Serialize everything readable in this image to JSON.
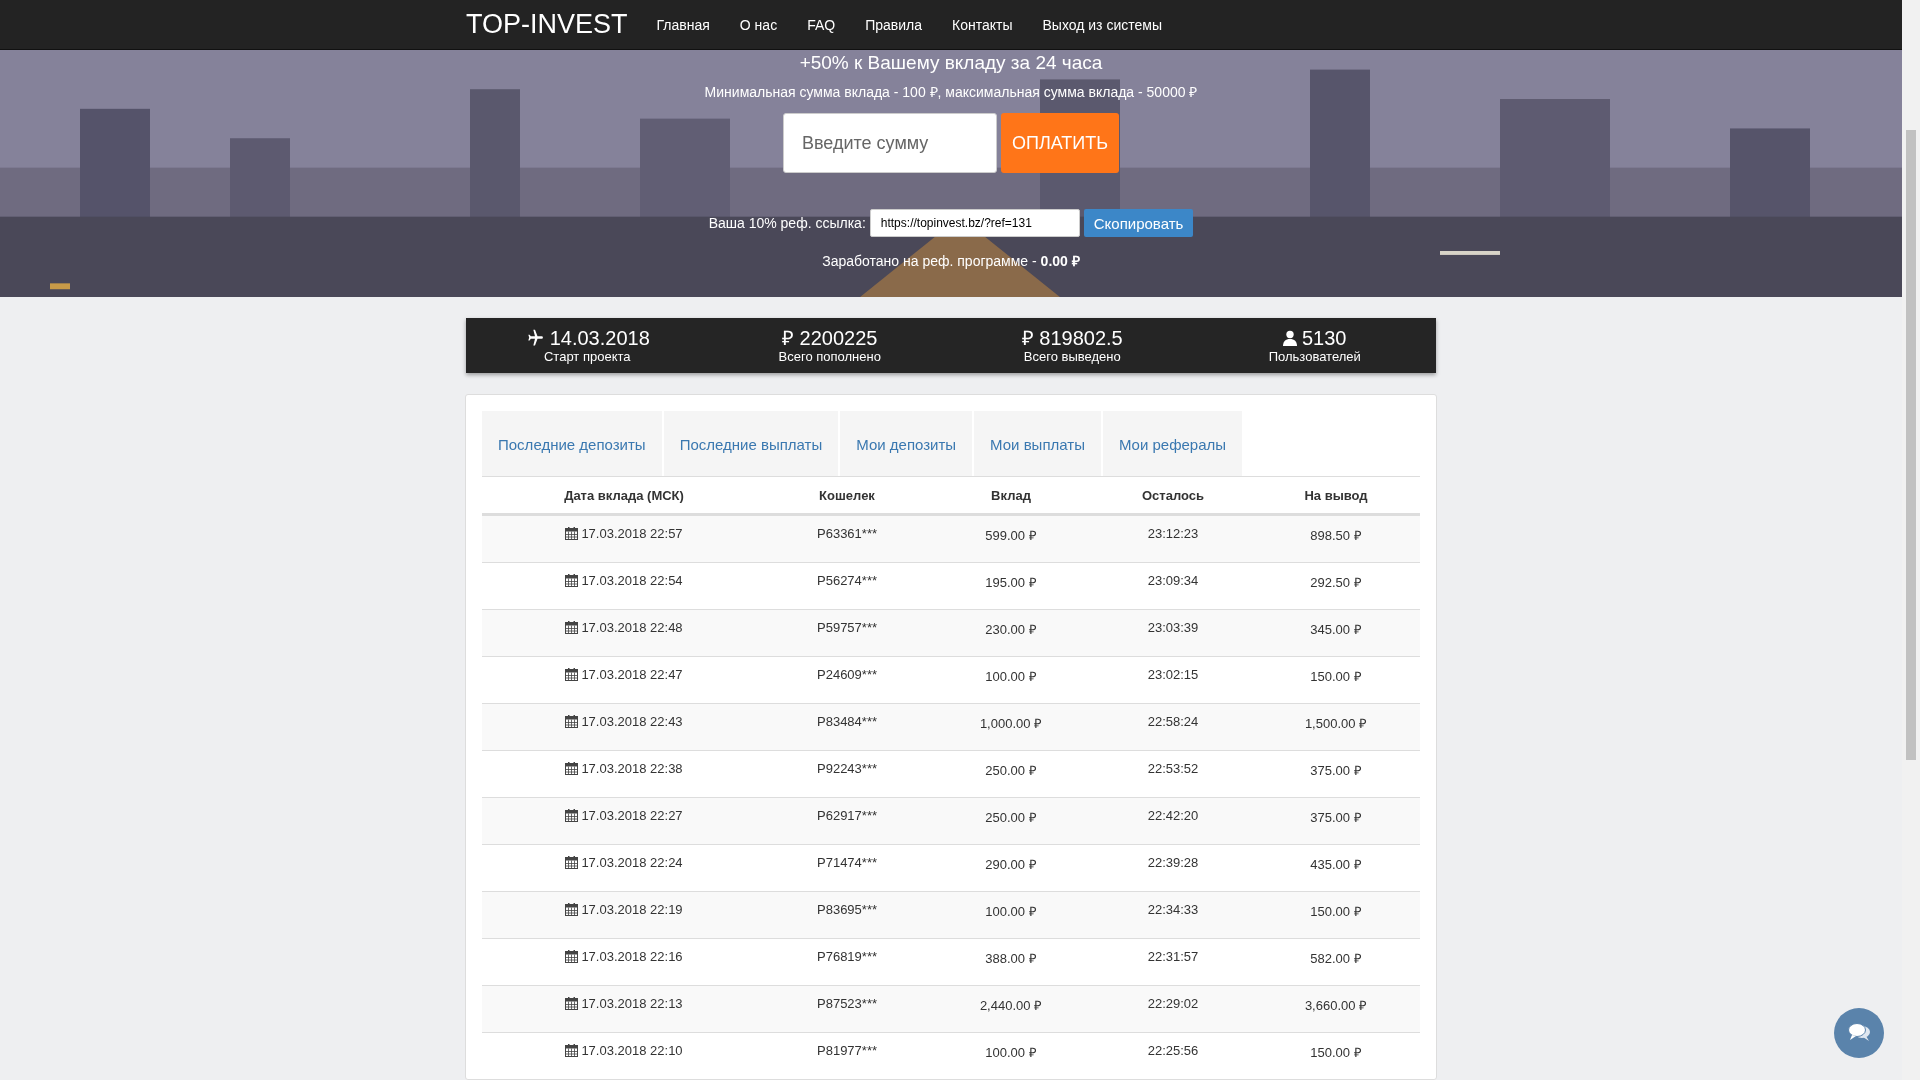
{
  "header": {
    "logo": "TOP-INVEST",
    "nav": [
      {
        "label": "Главная"
      },
      {
        "label": "О нас"
      },
      {
        "label": "FAQ"
      },
      {
        "label": "Правила"
      },
      {
        "label": "Контакты"
      },
      {
        "label": "Выход из системы"
      }
    ]
  },
  "hero": {
    "kind": "picture",
    "title": "+50% к Вашему вкладу за 24 часа",
    "limits": "Минимальная сумма вклада - 100 ₽, максимальная сумма вклада - 50000 ₽",
    "amount": {
      "placeholder": "Введите сумму"
    },
    "pay_button": "ОПЛАТИТЬ",
    "ref_label": "Ваша 10% реф. ссылка:",
    "ref_link": "https://topinvest.bz/?ref=131",
    "copy_button": "Скопировать",
    "earned": "Заработано на реф. программе - **0.00 ₽**"
  },
  "stats": [
    {
      "kind": "plane",
      "value": "14.03.2018",
      "label": "Старт проекта"
    },
    {
      "kind": "plain",
      "value": "₽ 2200225",
      "label": "Всего пополнено"
    },
    {
      "kind": "plain",
      "value": "₽ 819802.5",
      "label": "Всего выведено"
    },
    {
      "kind": "user",
      "value": "5130",
      "label": "Пользователей"
    }
  ],
  "tabs": [
    {
      "label": "Последние депозиты",
      "selected": false
    },
    {
      "label": "Последние выплаты",
      "selected": false
    },
    {
      "label": "Мои депозиты",
      "selected": false
    },
    {
      "label": "Мои выплаты",
      "selected": false
    },
    {
      "label": "Мои рефералы",
      "selected": false
    }
  ],
  "table": {
    "columns": [
      "Дата вклада (МСК)",
      "Кошелек",
      "Вклад",
      "Осталось",
      "На вывод"
    ],
    "rows": [
      [
        "17.03.2018 22:57",
        "P63361***",
        "599.00 ₽",
        "23:12:23",
        "898.50 ₽"
      ],
      [
        "17.03.2018 22:54",
        "P56274***",
        "195.00 ₽",
        "23:09:34",
        "292.50 ₽"
      ],
      [
        "17.03.2018 22:48",
        "P59757***",
        "230.00 ₽",
        "23:03:39",
        "345.00 ₽"
      ],
      [
        "17.03.2018 22:47",
        "P24609***",
        "100.00 ₽",
        "23:02:15",
        "150.00 ₽"
      ],
      [
        "17.03.2018 22:43",
        "P83484***",
        "1,000.00 ₽",
        "22:58:24",
        "1,500.00 ₽"
      ],
      [
        "17.03.2018 22:38",
        "P92243***",
        "250.00 ₽",
        "22:53:52",
        "375.00 ₽"
      ],
      [
        "17.03.2018 22:27",
        "P62917***",
        "250.00 ₽",
        "22:42:20",
        "375.00 ₽"
      ],
      [
        "17.03.2018 22:24",
        "P71474***",
        "290.00 ₽",
        "22:39:28",
        "435.00 ₽"
      ],
      [
        "17.03.2018 22:19",
        "P83695***",
        "100.00 ₽",
        "22:34:33",
        "150.00 ₽"
      ],
      [
        "17.03.2018 22:16",
        "P76819***",
        "388.00 ₽",
        "22:31:57",
        "582.00 ₽"
      ],
      [
        "17.03.2018 22:13",
        "P87523***",
        "2,440.00 ₽",
        "22:29:02",
        "3,660.00 ₽"
      ],
      [
        "17.03.2018 22:10",
        "P81977***",
        "100.00 ₽",
        "22:25:56",
        "150.00 ₽"
      ]
    ]
  }
}
